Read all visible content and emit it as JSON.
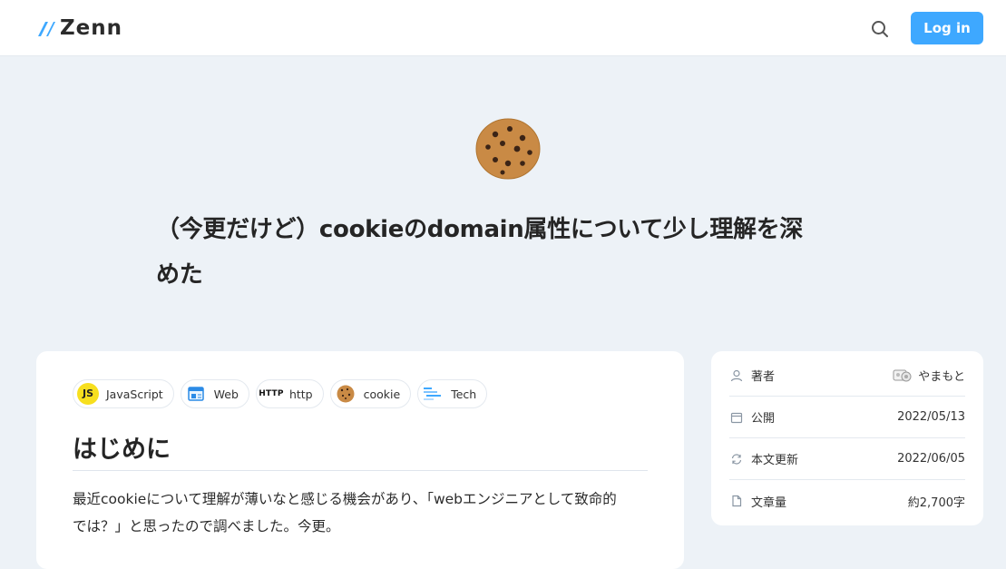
{
  "header": {
    "logo_text": "Zenn",
    "login_label": "Log in"
  },
  "article": {
    "emoji": "cookie",
    "title_line1": "（今更だけど）cookieのdomain属性について少し理解を深",
    "title_line2": "めた",
    "topics": [
      {
        "label": "JavaScript",
        "icon": "javascript-icon"
      },
      {
        "label": "Web",
        "icon": "web-icon"
      },
      {
        "label": "http",
        "icon": "http-icon"
      },
      {
        "label": "cookie",
        "icon": "cookie-icon"
      },
      {
        "label": "Tech",
        "icon": "tech-icon"
      }
    ],
    "heading": "はじめに",
    "paragraph_line1": "最近cookieについて理解が薄いなと感じる機会があり、「webエンジニアとして致命的",
    "paragraph_line2": "では？」と思ったので調べました。今更。",
    "js_icon_text": "JS",
    "http_icon_text": "HTTP"
  },
  "sidebar": {
    "author_label": "著者",
    "author_name": "やまもと",
    "published_label": "公開",
    "published_value": "2022/05/13",
    "updated_label": "本文更新",
    "updated_value": "2022/06/05",
    "length_label": "文章量",
    "length_value": "約2,700字"
  },
  "colors": {
    "accent": "#3ea8ff",
    "background": "#edf2f7"
  }
}
